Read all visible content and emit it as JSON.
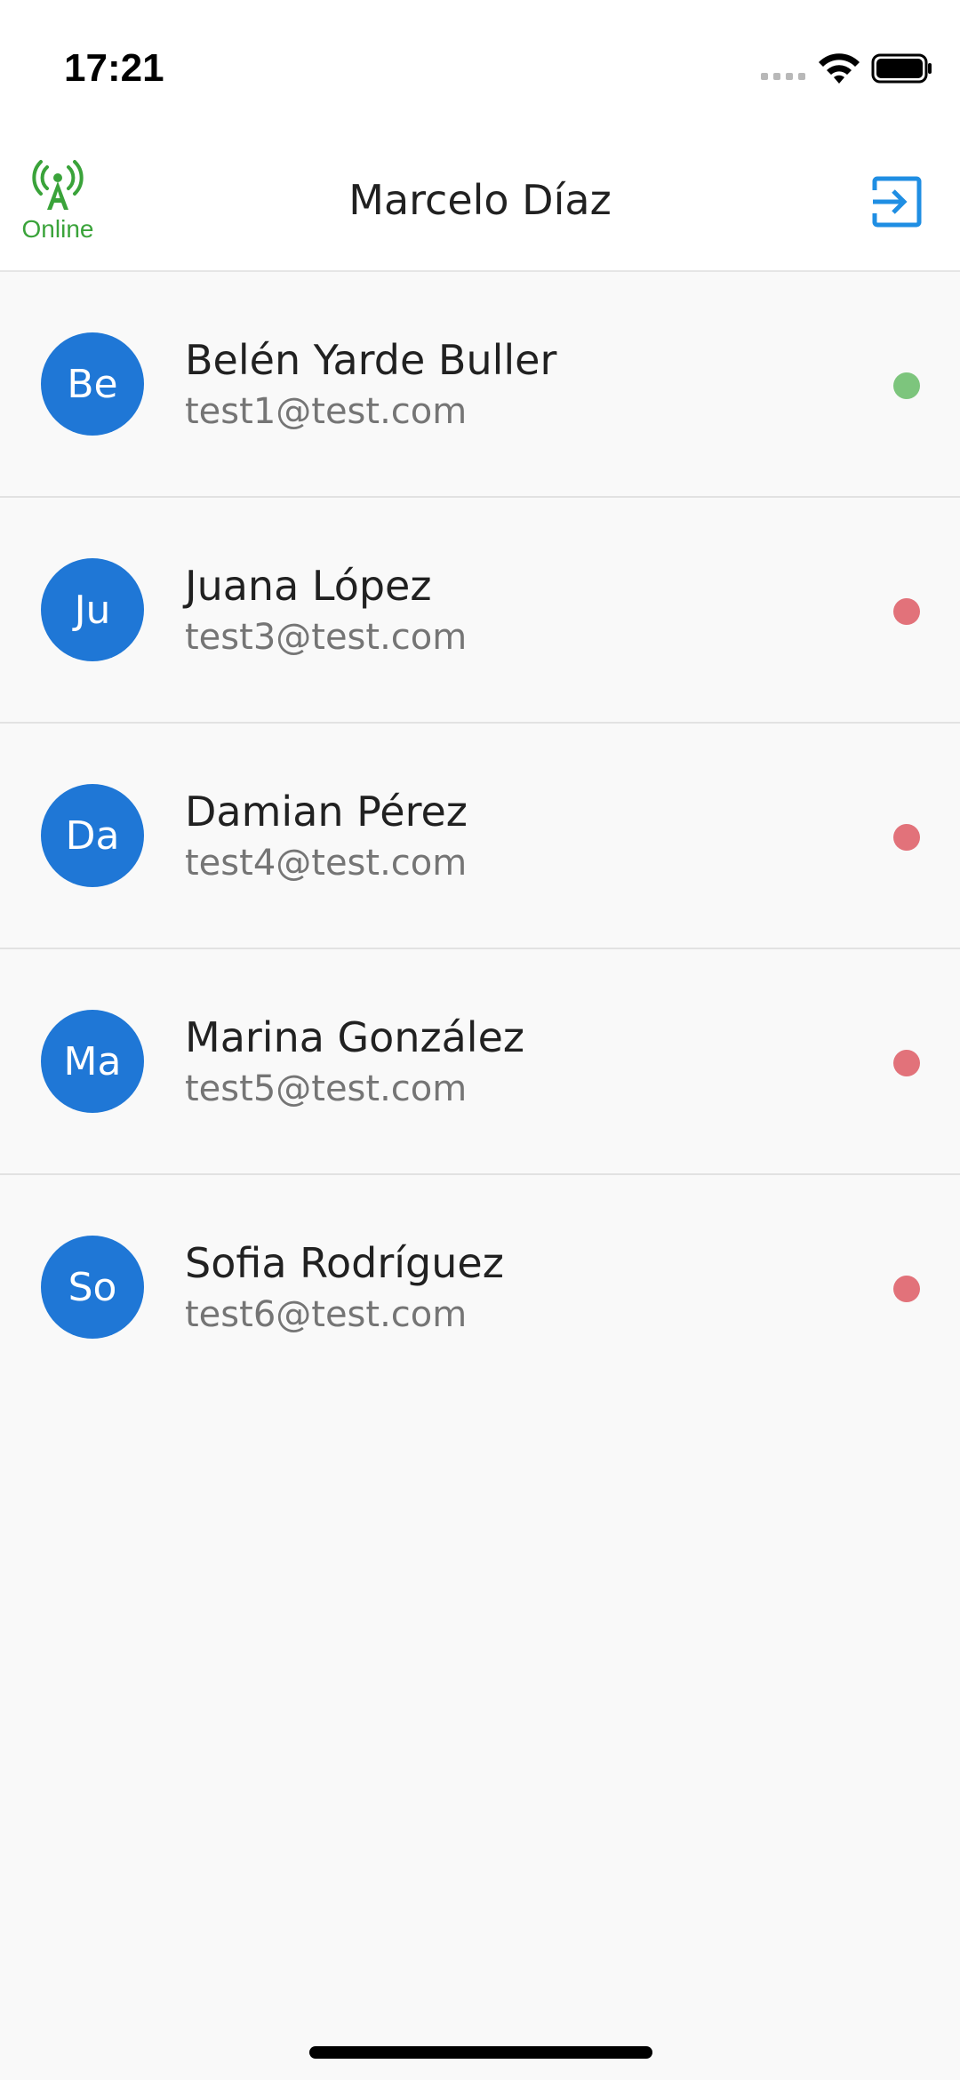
{
  "status_bar": {
    "time": "17:21",
    "icons": [
      "signal-dots",
      "wifi-icon",
      "battery-icon"
    ]
  },
  "app_bar": {
    "connection_label": "Online",
    "connection_icon": "antenna-icon",
    "title": "Marcelo Díaz",
    "logout_icon": "logout-icon",
    "online_color": "#3aa33a",
    "accent_color": "#1f8ee3"
  },
  "users": [
    {
      "initials": "Be",
      "name": "Belén Yarde Buller",
      "email": "test1@test.com",
      "online": true
    },
    {
      "initials": "Ju",
      "name": "Juana López",
      "email": "test3@test.com",
      "online": false
    },
    {
      "initials": "Da",
      "name": "Damian Pérez",
      "email": "test4@test.com",
      "online": false
    },
    {
      "initials": "Ma",
      "name": "Marina González",
      "email": "test5@test.com",
      "online": false
    },
    {
      "initials": "So",
      "name": "Sofia Rodríguez",
      "email": "test6@test.com",
      "online": false
    }
  ],
  "colors": {
    "avatar": "#1f77d6",
    "online_dot": "#7dc57d",
    "offline_dot": "#e2727a"
  }
}
